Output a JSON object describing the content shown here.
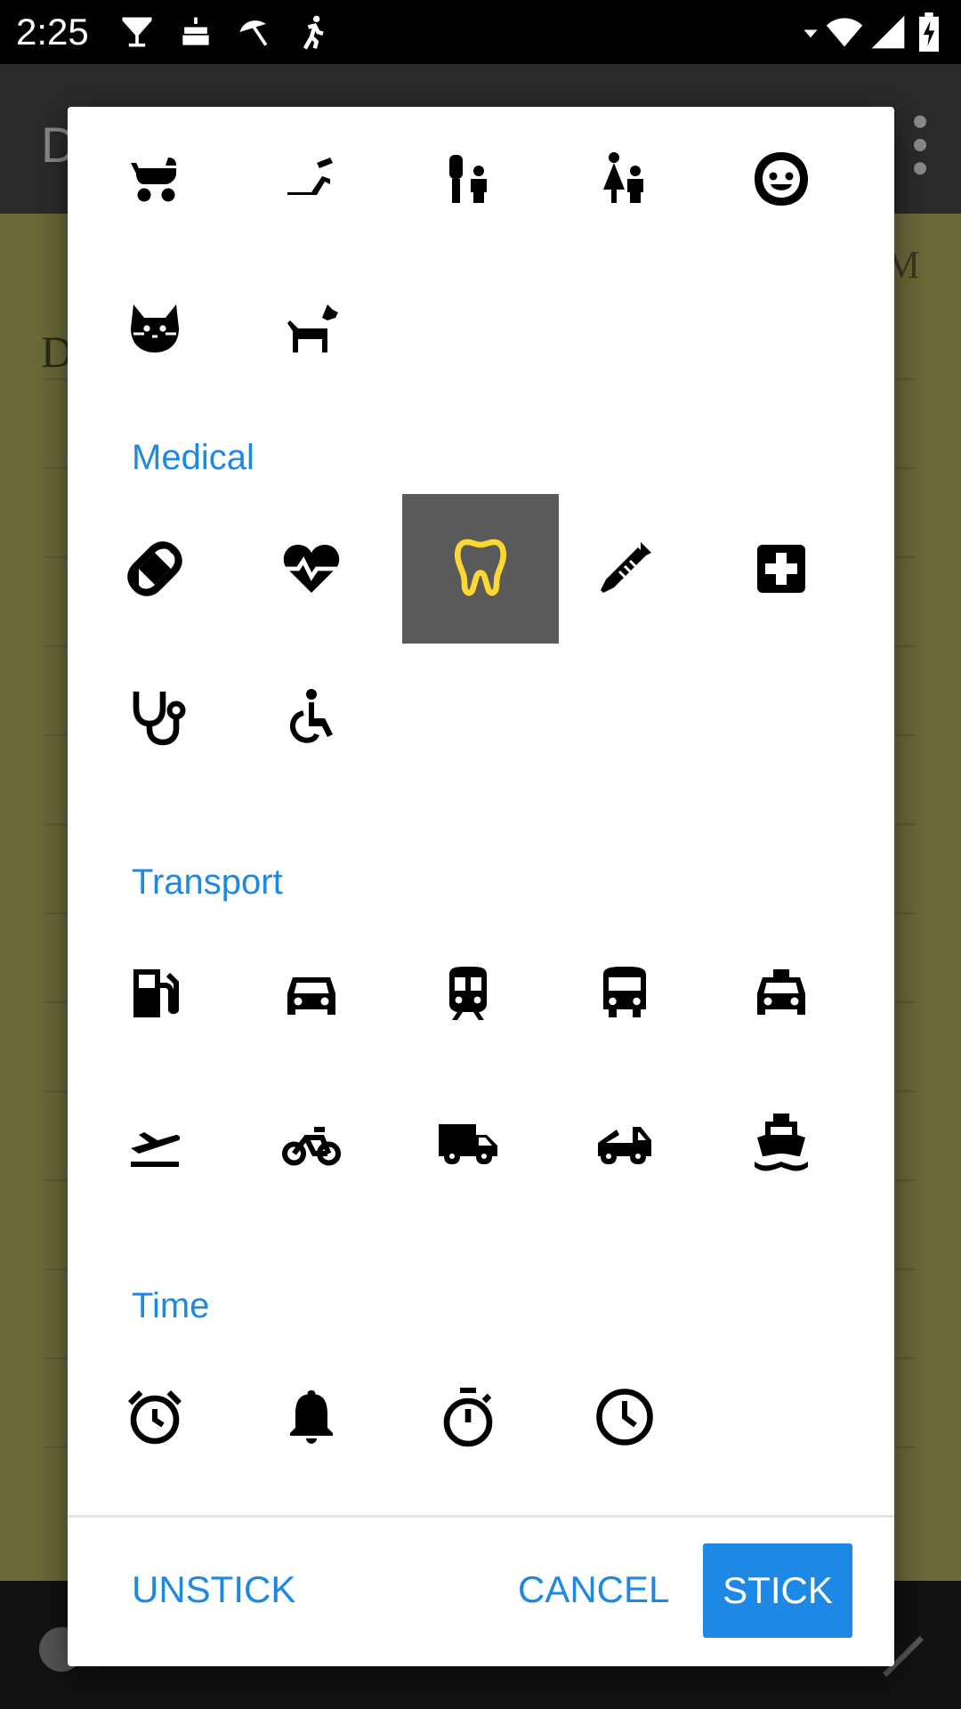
{
  "status_bar": {
    "time": "2:25",
    "left_icons": [
      "cocktail-icon",
      "cake-icon",
      "beach-umbrella-icon",
      "running-icon"
    ],
    "right_icons": [
      "dropdown-arrow-icon",
      "wifi-icon",
      "signal-icon",
      "battery-charging-icon"
    ]
  },
  "background_app": {
    "title_initial": "D",
    "note_initial": "D",
    "note_right_text": "M"
  },
  "dialog": {
    "sections": [
      {
        "title": "",
        "icons": [
          "stroller-icon",
          "slide-icon",
          "family-restroom-icon",
          "baby-changing-icon",
          "child-face-icon",
          "cat-icon",
          "dog-icon"
        ]
      },
      {
        "title": "Medical",
        "icons": [
          "pill-icon",
          "heart-monitor-icon",
          "tooth-icon",
          "syringe-icon",
          "medical-cross-icon",
          "stethoscope-icon",
          "wheelchair-icon"
        ],
        "selected": "tooth-icon"
      },
      {
        "title": "Transport",
        "icons": [
          "gas-station-icon",
          "car-icon",
          "train-icon",
          "bus-icon",
          "taxi-icon",
          "flight-takeoff-icon",
          "bicycle-icon",
          "truck-icon",
          "tow-truck-icon",
          "ferry-icon"
        ]
      },
      {
        "title": "Time",
        "icons": [
          "alarm-icon",
          "bell-icon",
          "stopwatch-icon",
          "clock-icon"
        ]
      }
    ],
    "selected_color": "#fdd835",
    "accent_color": "#1e88e5",
    "buttons": {
      "unstick": "UNSTICK",
      "cancel": "CANCEL",
      "stick": "STICK"
    }
  }
}
